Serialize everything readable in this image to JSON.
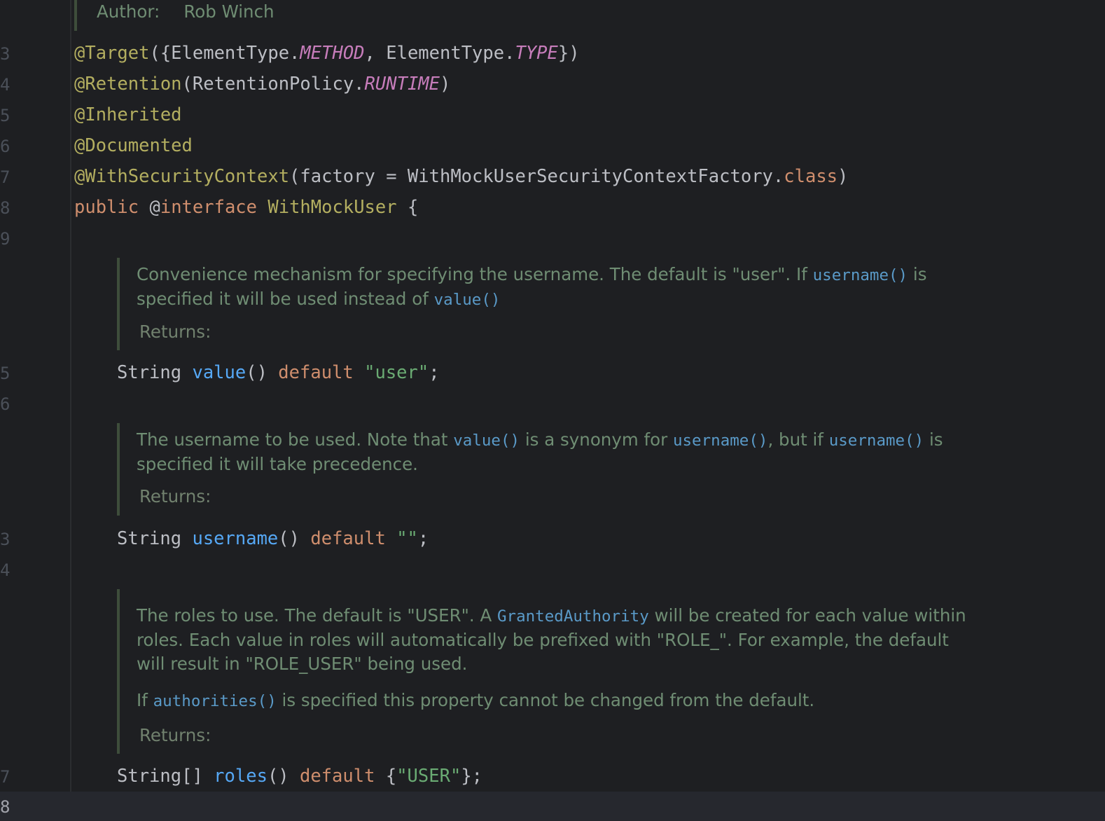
{
  "editor": {
    "author": {
      "label": "Author:",
      "name": "Rob Winch"
    },
    "gutter": {
      "l1": "3",
      "l2": "4",
      "l3": "5",
      "l4": "6",
      "l5": "7",
      "l6": "8",
      "l7": "9",
      "l8": "5",
      "l9": "6",
      "l10": "3",
      "l11": "4",
      "l12": "7",
      "l13": "8"
    },
    "lines": {
      "target": {
        "ann": "@Target",
        "p1": "({ElementType.",
        "c1": "METHOD",
        "p2": ", ElementType.",
        "c2": "TYPE",
        "p3": "})"
      },
      "retention": {
        "ann": "@Retention",
        "p1": "(RetentionPolicy.",
        "c1": "RUNTIME",
        "p2": ")"
      },
      "inherited": {
        "ann": "@Inherited"
      },
      "documented": {
        "ann": "@Documented"
      },
      "context": {
        "ann": "@WithSecurityContext",
        "p1": "(factory = WithMockUserSecurityContextFactory.",
        "kw": "class",
        "p2": ")"
      },
      "decl": {
        "kw1": "public",
        "sp1": " @",
        "kw2": "interface",
        "sp2": " ",
        "name": "WithMockUser",
        "p1": " {"
      },
      "value": {
        "type": "String ",
        "fn": "value",
        "p1": "() ",
        "kw": "default",
        "sp": " ",
        "str": "\"user\"",
        "p2": ";"
      },
      "username": {
        "type": "String ",
        "fn": "username",
        "p1": "() ",
        "kw": "default",
        "sp": " ",
        "str": "\"\"",
        "p2": ";"
      },
      "roles": {
        "type": "String[] ",
        "fn": "roles",
        "p1": "() ",
        "kw": "default",
        "sp": " {",
        "str": "\"USER\"",
        "p2": "};"
      }
    },
    "docs": {
      "value": {
        "t1": "Convenience mechanism for specifying the username. The default is \"user\". If ",
        "r1": "username()",
        "t2": " is specified it will be used instead of ",
        "r2": "value()",
        "returns": "Returns:"
      },
      "username": {
        "t1": "The username to be used. Note that ",
        "r1": "value()",
        "t2": " is a synonym for ",
        "r2": "username()",
        "t3": ", but if ",
        "r3": "username()",
        "t4": " is specified it will take precedence.",
        "returns": "Returns:"
      },
      "roles": {
        "t1": "The roles to use. The default is \"USER\". A ",
        "r1": "GrantedAuthority",
        "t2": " will be created for each value within roles. Each value in roles will automatically be prefixed with \"ROLE_\". For example, the default will result in \"ROLE_USER\" being used.",
        "p2a": "If ",
        "r2": "authorities()",
        "p2b": " is specified this property cannot be changed from the default.",
        "returns": "Returns:"
      }
    }
  }
}
